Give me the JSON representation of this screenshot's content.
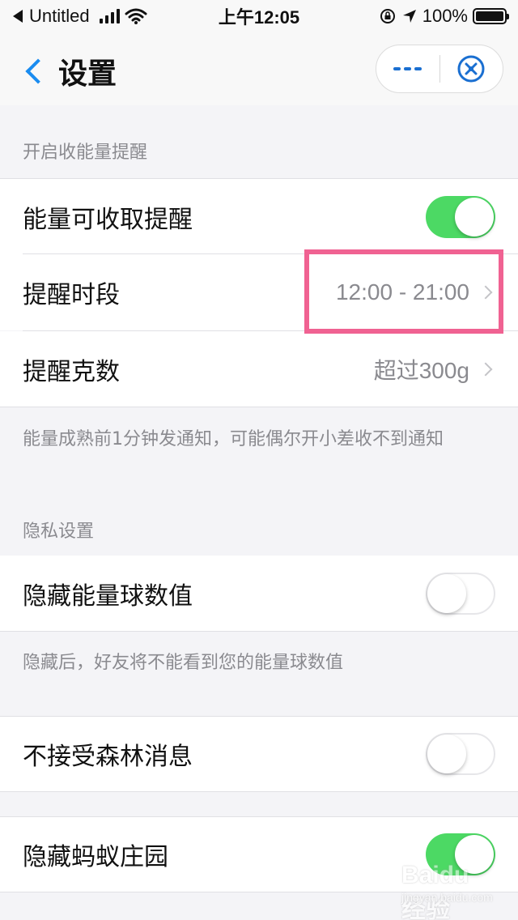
{
  "status_bar": {
    "back_app": "Untitled",
    "time": "上午12:05",
    "battery": "100%"
  },
  "nav": {
    "title": "设置",
    "back_icon": "chevron-left-icon",
    "more_icon": "more-icon",
    "close_icon": "close-circle-icon",
    "accent_color": "#1a8cf0"
  },
  "sections": {
    "energy_reminder": {
      "header": "开启收能量提醒",
      "rows": {
        "collectable": {
          "label": "能量可收取提醒",
          "toggle_on": true
        },
        "period": {
          "label": "提醒时段",
          "value": "12:00 - 21:00"
        },
        "grams": {
          "label": "提醒克数",
          "value": "超过300g"
        }
      },
      "footnote": "能量成熟前1分钟发通知，可能偶尔开小差收不到通知"
    },
    "privacy": {
      "header": "隐私设置",
      "rows": {
        "hide_energy": {
          "label": "隐藏能量球数值",
          "toggle_on": false
        }
      },
      "footnote": "隐藏后，好友将不能看到您的能量球数值"
    },
    "forest_messages": {
      "rows": {
        "reject_messages": {
          "label": "不接受森林消息",
          "toggle_on": false
        }
      }
    },
    "manor": {
      "rows": {
        "hide_manor": {
          "label": "隐藏蚂蚁庄园",
          "toggle_on": true
        }
      }
    }
  },
  "toggle_on_color": "#4cd964",
  "highlight_color": "#f06292",
  "watermark": {
    "logo": "Baidu经验",
    "sub": "jingyan.baidu.com"
  }
}
